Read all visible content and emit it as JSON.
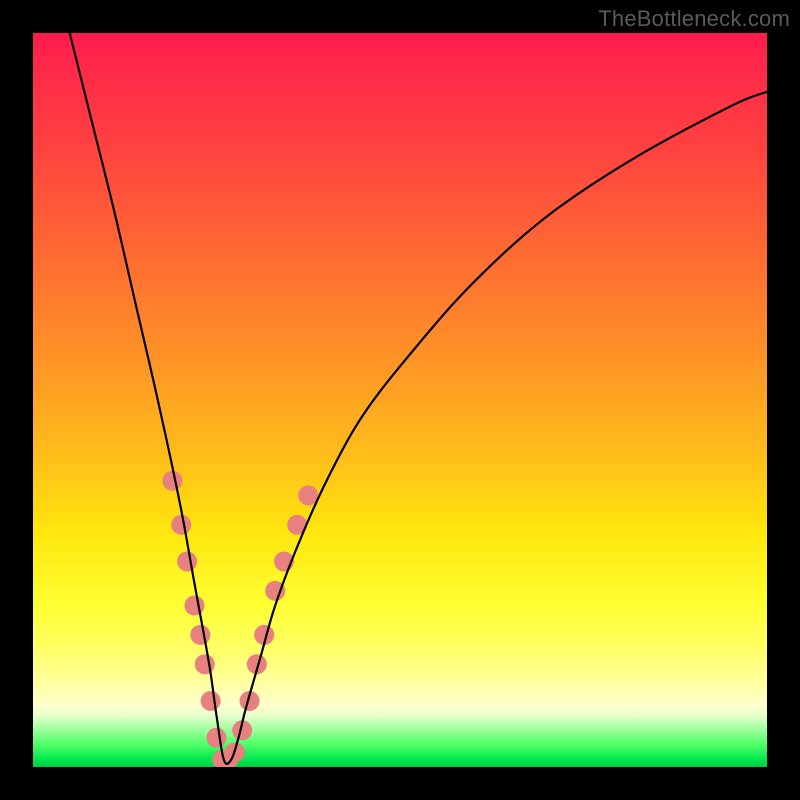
{
  "watermark": "TheBottleneck.com",
  "chart_data": {
    "type": "line",
    "title": "",
    "xlabel": "",
    "ylabel": "",
    "xlim": [
      0,
      100
    ],
    "ylim": [
      0,
      100
    ],
    "curve": {
      "comment": "V-shaped bottleneck curve; y is height from bottom (0=green bottom, 100=red top). Left branch steep from top-left down to minimum near x≈26, right branch rises logarithmically toward top-right.",
      "x": [
        5,
        8,
        11,
        14,
        17,
        20,
        22,
        24,
        25,
        26,
        27,
        28,
        29,
        31,
        33,
        36,
        40,
        45,
        52,
        60,
        70,
        82,
        95,
        100
      ],
      "y": [
        100,
        88,
        76,
        63,
        50,
        36,
        25,
        14,
        7,
        1,
        1,
        4,
        8,
        15,
        22,
        30,
        39,
        48,
        57,
        66,
        75,
        83,
        90,
        92
      ]
    },
    "markers": {
      "comment": "salmon dots clustered around the minimum on both branches",
      "color": "#e98080",
      "radius_px": 10,
      "points": [
        {
          "x": 19.0,
          "y": 39
        },
        {
          "x": 20.2,
          "y": 33
        },
        {
          "x": 21.0,
          "y": 28
        },
        {
          "x": 22.0,
          "y": 22
        },
        {
          "x": 22.8,
          "y": 18
        },
        {
          "x": 23.4,
          "y": 14
        },
        {
          "x": 24.2,
          "y": 9
        },
        {
          "x": 25.0,
          "y": 4
        },
        {
          "x": 25.8,
          "y": 1
        },
        {
          "x": 26.6,
          "y": 1
        },
        {
          "x": 27.5,
          "y": 2
        },
        {
          "x": 28.5,
          "y": 5
        },
        {
          "x": 29.5,
          "y": 9
        },
        {
          "x": 30.5,
          "y": 14
        },
        {
          "x": 31.5,
          "y": 18
        },
        {
          "x": 33.0,
          "y": 24
        },
        {
          "x": 34.2,
          "y": 28
        },
        {
          "x": 36.0,
          "y": 33
        },
        {
          "x": 37.5,
          "y": 37
        }
      ]
    }
  }
}
